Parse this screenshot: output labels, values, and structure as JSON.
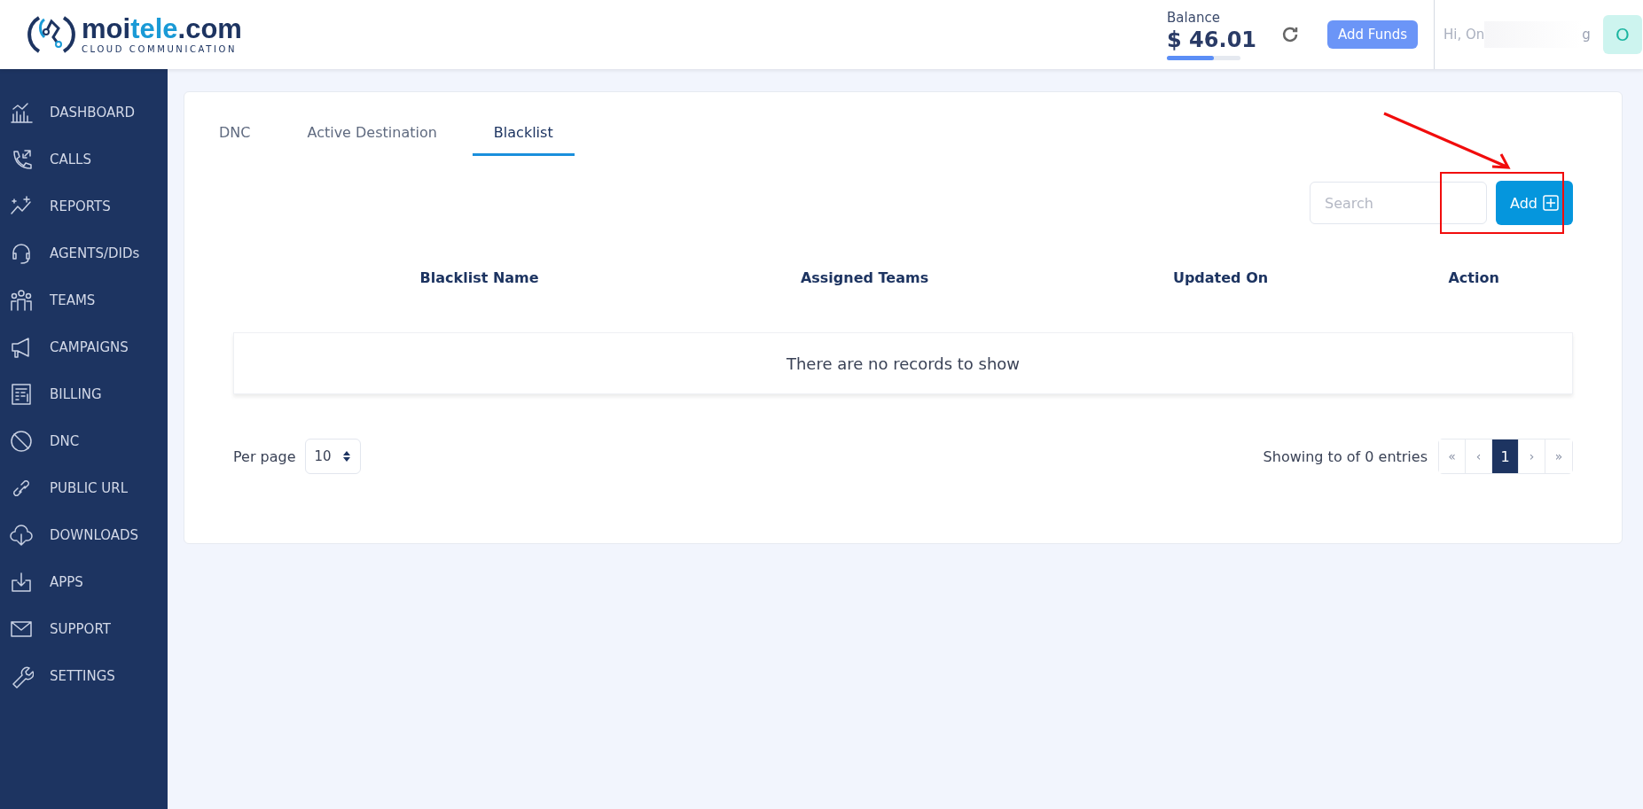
{
  "header": {
    "logo": {
      "name_a": "moi",
      "name_b": "tele",
      "name_c": ".com",
      "tagline": "CLOUD COMMUNICATION"
    },
    "balance": {
      "label": "Balance",
      "amount": "$ 46.01",
      "level": 0.64
    },
    "add_funds": "Add Funds",
    "greeting_start": "Hi, On",
    "greeting_end": "g",
    "avatar": "O"
  },
  "sidebar": {
    "items": [
      {
        "label": "DASHBOARD"
      },
      {
        "label": "CALLS"
      },
      {
        "label": "REPORTS"
      },
      {
        "label": "AGENTS/DIDs"
      },
      {
        "label": "TEAMS"
      },
      {
        "label": "CAMPAIGNS"
      },
      {
        "label": "BILLING"
      },
      {
        "label": "DNC"
      },
      {
        "label": "PUBLIC URL"
      },
      {
        "label": "DOWNLOADS"
      },
      {
        "label": "APPS"
      },
      {
        "label": "SUPPORT"
      },
      {
        "label": "SETTINGS"
      }
    ]
  },
  "tabs": [
    {
      "label": "DNC",
      "selected": false
    },
    {
      "label": "Active Destination",
      "selected": false
    },
    {
      "label": "Blacklist",
      "selected": true
    }
  ],
  "search": {
    "placeholder": "Search"
  },
  "add_button": "Add",
  "table": {
    "columns": [
      "Blacklist Name",
      "Assigned Teams",
      "Updated On",
      "Action"
    ],
    "empty_message": "There are no records to show"
  },
  "footer": {
    "per_page_label": "Per page",
    "per_page_value": "10",
    "showing": "Showing to of 0 entries",
    "pages": [
      {
        "label": "«",
        "selected": false
      },
      {
        "label": "‹",
        "selected": false
      },
      {
        "label": "1",
        "selected": true
      },
      {
        "label": "›",
        "selected": false
      },
      {
        "label": "»",
        "selected": false
      }
    ]
  }
}
